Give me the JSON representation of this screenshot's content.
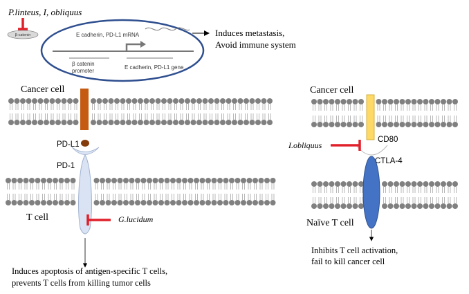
{
  "top": {
    "inhibitors": "P.linteus, I, obliquus",
    "bcatenin_chip": "β-catenin",
    "mrna_label": "E cadherin, PD-L1 mRNA",
    "promoter_label_1": "β catenin",
    "promoter_label_2": "promoter",
    "gene_label": "E cadherin, PD-L1 gene",
    "outcome_1": "Induces metastasis,",
    "outcome_2": "Avoid immune system"
  },
  "left_panel": {
    "cancer_cell_label": "Cancer cell",
    "pdl1_label": "PD-L1",
    "pd1_label": "PD-1",
    "t_cell_label": "T cell",
    "inhibitor": "G.lucidum",
    "outcome_1": "Induces apoptosis of antigen-specific T cells,",
    "outcome_2": "prevents T cells from killing  tumor cells"
  },
  "right_panel": {
    "cancer_cell_label": "Cancer cell",
    "cd80_label": "CD80",
    "inhibitor": "I.obliquus",
    "ctla4_label": "CTLA-4",
    "naive_t_cell_label": "Naïve T cell",
    "outcome_1": "Inhibits T cell activation,",
    "outcome_2": "fail to kill  cancer cell"
  },
  "colors": {
    "membrane_head": "#808080",
    "inhibition": "#e0202a",
    "pdl1_bar": "#c55a11",
    "cd80_bar": "#ffd966",
    "pd1_fill": "#dae3f3",
    "ctla4_fill": "#4472c4",
    "ellipse_border": "#2f4f8f"
  }
}
